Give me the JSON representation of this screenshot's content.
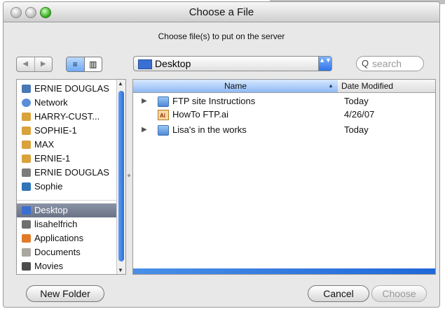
{
  "window": {
    "title": "Choose a File",
    "prompt": "Choose file(s) to put on the server"
  },
  "toolbar": {
    "back_icon": "◀",
    "forward_icon": "▶",
    "list_view_icon": "≡",
    "column_view_icon": "▥",
    "location": "Desktop",
    "location_arrow": "▲▼",
    "search_placeholder": "search",
    "search_icon": "Q"
  },
  "sidebar": {
    "items": [
      {
        "label": "ERNIE DOUGLAS",
        "icon": "computer-icon",
        "color": "#4a78b6"
      },
      {
        "label": "Network",
        "icon": "network-icon",
        "color": "#5a8fd8"
      },
      {
        "label": "HARRY-CUST...",
        "icon": "server-icon",
        "color": "#d9a23b"
      },
      {
        "label": "SOPHIE-1",
        "icon": "server-icon",
        "color": "#d9a23b"
      },
      {
        "label": "MAX",
        "icon": "server-icon",
        "color": "#d9a23b"
      },
      {
        "label": "ERNIE-1",
        "icon": "server-icon",
        "color": "#d9a23b"
      },
      {
        "label": "ERNIE DOUGLAS",
        "icon": "drive-icon",
        "color": "#7c7c7c"
      },
      {
        "label": "Sophie",
        "icon": "drive-icon",
        "color": "#2f74b8"
      },
      {
        "label": "Desktop",
        "icon": "desktop-icon",
        "color": "#3b6fd1",
        "selected": true
      },
      {
        "label": "lisahelfrich",
        "icon": "home-icon",
        "color": "#6f6f6f"
      },
      {
        "label": "Applications",
        "icon": "applications-icon",
        "color": "#e07a28"
      },
      {
        "label": "Documents",
        "icon": "documents-icon",
        "color": "#aaa6a0"
      },
      {
        "label": "Movies",
        "icon": "movies-icon",
        "color": "#4b4b4b"
      }
    ],
    "scroll_up": "▲",
    "scroll_down": "▼"
  },
  "browser": {
    "columns": [
      "Name",
      "Date Modified"
    ],
    "sort_icon": "▲",
    "rows": [
      {
        "name": "FTP site Instructions",
        "date": "Today",
        "kind": "folder",
        "disclosure": "▶"
      },
      {
        "name": "HowTo FTP.ai",
        "date": "4/26/07",
        "kind": "ai",
        "disclosure": ""
      },
      {
        "name": "Lisa's in the works",
        "date": "Today",
        "kind": "folder",
        "disclosure": "▶"
      }
    ]
  },
  "buttons": {
    "new_folder": "New Folder",
    "cancel": "Cancel",
    "choose": "Choose"
  }
}
